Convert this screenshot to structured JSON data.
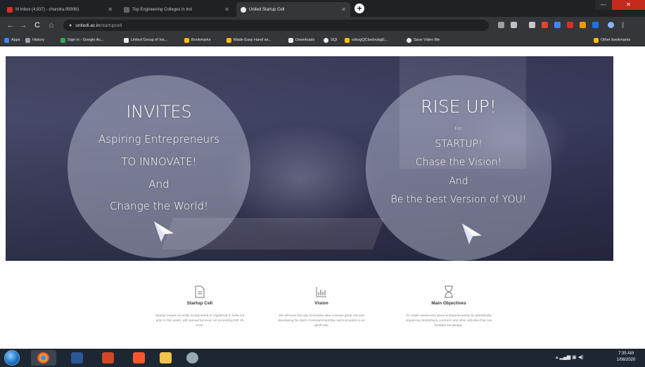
{
  "browser": {
    "tabs": [
      {
        "label": "M Inbox (4,937) - chandra.059081",
        "active": false
      },
      {
        "label": "Top Engineering Colleges in Ind",
        "active": false
      },
      {
        "label": "United Startup Cell",
        "active": true
      }
    ],
    "new_tab": "+",
    "minimize": "—",
    "close": "✕",
    "nav": {
      "back": "←",
      "forward": "→",
      "reload": "C",
      "home": "⌂"
    },
    "url_host": "unitedi.ac.in",
    "url_path": "/startupcell",
    "bookmarks": [
      {
        "label": "Apps"
      },
      {
        "label": "History"
      },
      {
        "label": "Sign in - Google Ac..."
      },
      {
        "label": "United Group of Ins..."
      },
      {
        "label": "Bookmarks"
      },
      {
        "label": "Made Easy Hand wr..."
      },
      {
        "label": "Downloads"
      },
      {
        "label": "SQI"
      },
      {
        "label": "sdsvgQCbsdxvbgE..."
      },
      {
        "label": "Save Video Me"
      },
      {
        "label": "Other bookmarks"
      }
    ]
  },
  "hero": {
    "left": {
      "title": "INVITES",
      "lines": [
        "Aspiring Entrepreneurs",
        "TO INNOVATE!",
        "And",
        "Change the World!"
      ]
    },
    "right": {
      "title": "RISE UP!",
      "small": "For",
      "lines": [
        "STARTUP!",
        "Chase the Vision!",
        "And",
        "Be the best Version of YOU!"
      ]
    }
  },
  "features": [
    {
      "icon": "document-icon",
      "title": "Startup Cell",
      "desc": "Startup means an entity incorporated or registered in India not prior to five years, with annual turnover not exceeding INR 25 crore."
    },
    {
      "icon": "chart-icon",
      "title": "Vision",
      "desc": "We all know that any innovative idea conveys great risk and developing the spirit of entrepreneurship and innovation is an uphill task."
    },
    {
      "icon": "hourglass-icon",
      "title": "Main Objectives",
      "desc": "To create awareness about entrepreneurship by periodically organizing Workshops, Lectures and other activities that can facilitate knowledge."
    }
  ],
  "taskbar": {
    "time": "7:35 AM",
    "date": "1/08/2020"
  },
  "colors": {
    "hero_bg": "#3f4262",
    "circle_fill": "rgba(205,210,228,0.42)",
    "tab_strip": "#202124",
    "toolbar": "#35363a",
    "taskbar": "#1c2733"
  }
}
